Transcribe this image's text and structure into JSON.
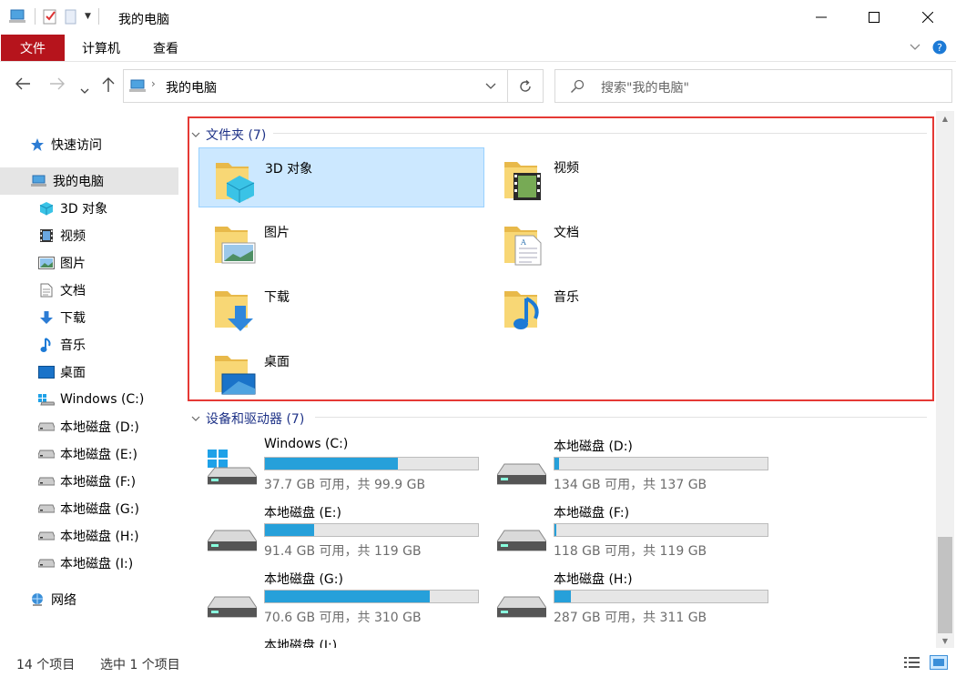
{
  "window": {
    "title": "我的电脑"
  },
  "ribbon": {
    "tabs": [
      "文件",
      "计算机",
      "查看"
    ]
  },
  "address": {
    "path": "我的电脑"
  },
  "search": {
    "placeholder": "搜索\"我的电脑\""
  },
  "sidebar": {
    "items": [
      {
        "label": "快速访问",
        "icon": "star-icon"
      },
      {
        "label": "我的电脑",
        "icon": "computer-icon",
        "selected": true
      },
      {
        "label": "3D 对象",
        "icon": "cube-icon"
      },
      {
        "label": "视频",
        "icon": "film-icon"
      },
      {
        "label": "图片",
        "icon": "picture-icon"
      },
      {
        "label": "文档",
        "icon": "document-icon"
      },
      {
        "label": "下载",
        "icon": "download-icon"
      },
      {
        "label": "音乐",
        "icon": "music-icon"
      },
      {
        "label": "桌面",
        "icon": "desktop-icon"
      },
      {
        "label": "Windows (C:)",
        "icon": "windows-drive-icon"
      },
      {
        "label": "本地磁盘 (D:)",
        "icon": "drive-icon"
      },
      {
        "label": "本地磁盘 (E:)",
        "icon": "drive-icon"
      },
      {
        "label": "本地磁盘 (F:)",
        "icon": "drive-icon"
      },
      {
        "label": "本地磁盘 (G:)",
        "icon": "drive-icon"
      },
      {
        "label": "本地磁盘 (H:)",
        "icon": "drive-icon"
      },
      {
        "label": "本地磁盘 (I:)",
        "icon": "drive-icon"
      },
      {
        "label": "网络",
        "icon": "network-icon"
      }
    ]
  },
  "folders_group": {
    "header": "文件夹 (7)",
    "items": [
      {
        "label": "3D 对象",
        "icon": "cube-folder-icon",
        "selected": true
      },
      {
        "label": "视频",
        "icon": "video-folder-icon"
      },
      {
        "label": "图片",
        "icon": "pictures-folder-icon"
      },
      {
        "label": "文档",
        "icon": "documents-folder-icon"
      },
      {
        "label": "下载",
        "icon": "downloads-folder-icon"
      },
      {
        "label": "音乐",
        "icon": "music-folder-icon"
      },
      {
        "label": "桌面",
        "icon": "desktop-folder-icon"
      }
    ]
  },
  "drives_group": {
    "header": "设备和驱动器 (7)",
    "items": [
      {
        "name": "Windows (C:)",
        "info": "37.7 GB 可用，共 99.9 GB",
        "used_fraction": 0.623
      },
      {
        "name": "本地磁盘 (D:)",
        "info": "134 GB 可用，共 137 GB",
        "used_fraction": 0.022
      },
      {
        "name": "本地磁盘 (E:)",
        "info": "91.4 GB 可用，共 119 GB",
        "used_fraction": 0.232
      },
      {
        "name": "本地磁盘 (F:)",
        "info": "118 GB 可用，共 119 GB",
        "used_fraction": 0.008
      },
      {
        "name": "本地磁盘 (G:)",
        "info": "70.6 GB 可用，共 310 GB",
        "used_fraction": 0.772
      },
      {
        "name": "本地磁盘 (H:)",
        "info": "287 GB 可用，共 311 GB",
        "used_fraction": 0.077
      },
      {
        "name": "本地磁盘 (I:)",
        "info": "",
        "used_fraction": null
      }
    ]
  },
  "status": {
    "count": "14 个项目",
    "selected": "选中 1 个项目"
  },
  "colors": {
    "accent": "#26a0da",
    "file_tab": "#b6141c",
    "selection": "#cce8ff",
    "highlight_frame": "#e53935",
    "group_header": "#1e3287"
  }
}
